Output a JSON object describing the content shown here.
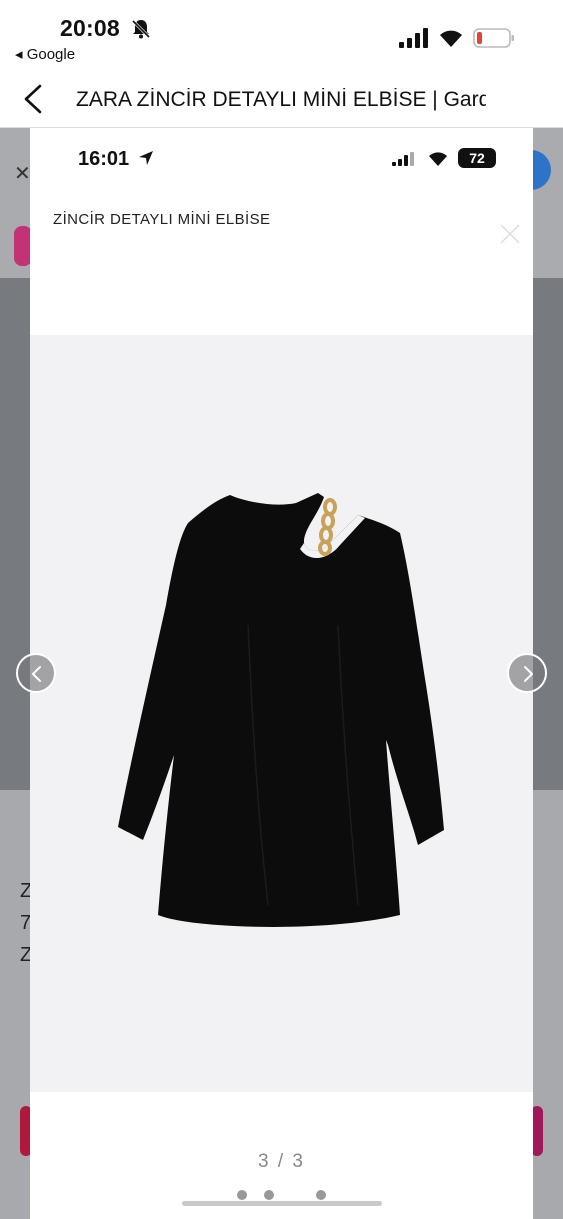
{
  "status_bar": {
    "time": "20:08",
    "back_app": "◂ Google"
  },
  "browser": {
    "page_title": "ZARA ZİNCİR DETAYLI MİNİ ELBİSE | Gard"
  },
  "screenshot": {
    "status_time": "16:01",
    "battery": "72",
    "product_title": "ZİNCİR DETAYLI MİNİ ELBİSE",
    "counter": "3 / 3"
  },
  "underlying": {
    "line1": "Z",
    "line2": "7",
    "line3": "Z"
  },
  "icons": {
    "bell": "bell-slash-icon",
    "signal": "signal-icon",
    "wifi": "wifi-icon",
    "battery": "battery-icon",
    "back": "chevron-left-icon",
    "close": "close-icon",
    "prev": "chevron-left-icon",
    "next": "chevron-right-icon"
  },
  "colors": {
    "battery_low": "#e0453a",
    "overlay": "#777b80",
    "gallery_bg": "#f2f2f4"
  }
}
